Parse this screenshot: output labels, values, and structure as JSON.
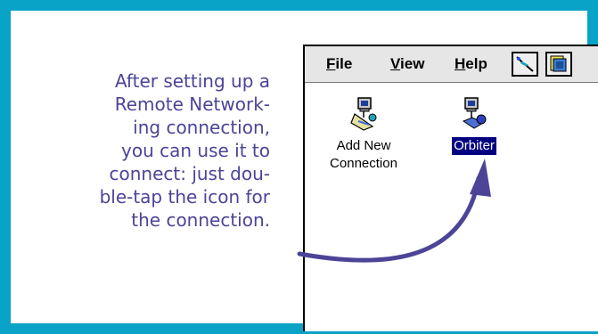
{
  "caption": {
    "lines": [
      "After setting up a",
      "Remote Network-",
      "ing connection,",
      "you can use it to",
      "connect: just dou-",
      "ble-tap the icon for",
      "the connection."
    ]
  },
  "menubar": {
    "file": {
      "first": "F",
      "rest": "ile"
    },
    "view": {
      "first": "V",
      "rest": "iew"
    },
    "help": {
      "first": "H",
      "rest": "elp"
    }
  },
  "icons": {
    "add_new": {
      "line1": "Add New",
      "line2": "Connection",
      "icon": "add-connection-icon"
    },
    "orbiter": {
      "label": "Orbiter",
      "icon": "network-connection-icon"
    }
  },
  "toolbar": {
    "tool1_icon": "connect-wizard-icon",
    "tool2_icon": "properties-icon"
  },
  "colors": {
    "frame": "#0aa3c8",
    "caption_text": "#4b4497",
    "arrow": "#4b4497",
    "selection": "#000080"
  }
}
